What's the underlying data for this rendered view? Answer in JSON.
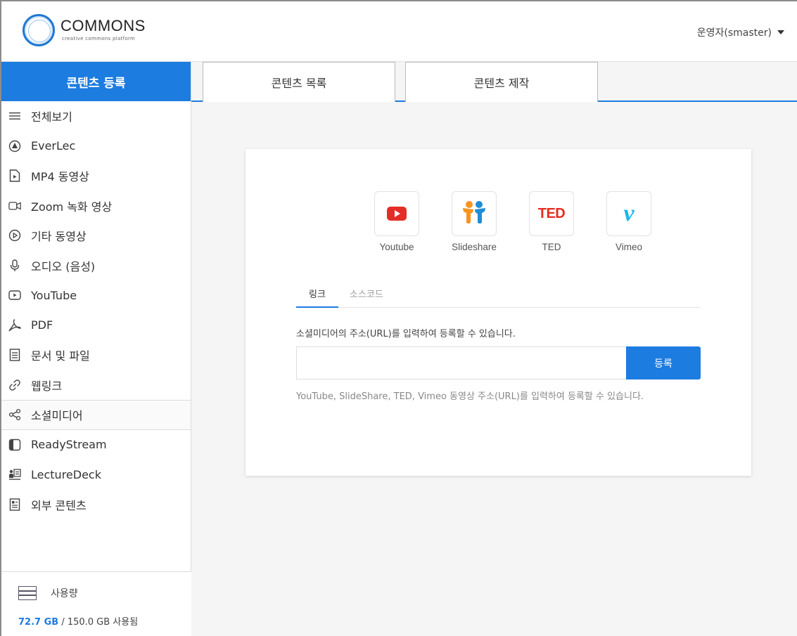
{
  "header": {
    "logo_title": "COMMONS",
    "logo_subtitle": "creative commons platform",
    "user_label": "운영자(smaster)"
  },
  "sidebar": {
    "heading": "콘텐츠 등록",
    "items": [
      {
        "label": "전체보기",
        "icon": "list-icon"
      },
      {
        "label": "EverLec",
        "icon": "everlec-icon"
      },
      {
        "label": "MP4 동영상",
        "icon": "video-file-icon"
      },
      {
        "label": "Zoom 녹화 영상",
        "icon": "zoom-icon"
      },
      {
        "label": "기타 동영상",
        "icon": "play-circle-icon"
      },
      {
        "label": "오디오 (음성)",
        "icon": "microphone-icon"
      },
      {
        "label": "YouTube",
        "icon": "youtube-icon"
      },
      {
        "label": "PDF",
        "icon": "pdf-icon"
      },
      {
        "label": "문서 및 파일",
        "icon": "document-icon"
      },
      {
        "label": "웹링크",
        "icon": "link-icon"
      },
      {
        "label": "소셜미디어",
        "icon": "share-icon",
        "active": true
      },
      {
        "label": "ReadyStream",
        "icon": "readystream-icon"
      },
      {
        "label": "LectureDeck",
        "icon": "lecturedeck-icon"
      },
      {
        "label": "외부 콘텐츠",
        "icon": "external-content-icon"
      }
    ],
    "usage": {
      "title": "사용량",
      "used": "72.7 GB",
      "rest": " / 150.0 GB 사용됨"
    }
  },
  "tabs": [
    "콘텐츠 목록",
    "콘텐츠 제작"
  ],
  "card": {
    "providers": [
      {
        "label": "Youtube",
        "icon": "youtube-logo-icon"
      },
      {
        "label": "Slideshare",
        "icon": "slideshare-logo-icon"
      },
      {
        "label": "TED",
        "icon": "ted-logo-icon",
        "mark": "TED"
      },
      {
        "label": "Vimeo",
        "icon": "vimeo-logo-icon",
        "mark": "v"
      }
    ],
    "subtabs": [
      "링크",
      "소스코드"
    ],
    "description": "소셜미디어의 주소(URL)를 입력하여 등록할 수 있습니다.",
    "url_value": "",
    "submit_label": "등록",
    "hint": "YouTube, SlideShare, TED, Vimeo 동영상 주소(URL)를 입력하여 등록할 수 있습니다."
  },
  "colors": {
    "accent": "#1c7ce0",
    "youtube_red": "#e52d27",
    "ted_red": "#e62b1e",
    "vimeo_blue": "#1ab7ea"
  }
}
